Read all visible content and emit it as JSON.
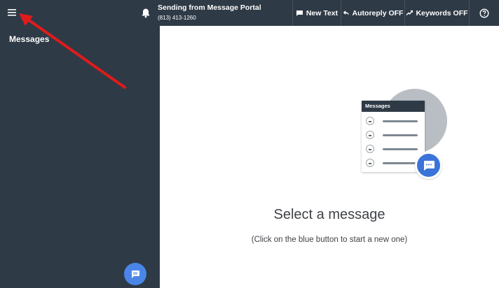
{
  "header": {
    "sender_title": "Sending from Message Portal",
    "sender_phone": "(813) 413-1260",
    "buttons": {
      "new_text": "New Text",
      "autoreply": "Autoreply OFF",
      "keywords": "Keywords OFF"
    }
  },
  "sidebar": {
    "title": "Messages"
  },
  "main": {
    "card_title": "Messages",
    "heading": "Select a message",
    "subtext": "(Click on the blue button to start a new one)"
  },
  "colors": {
    "topbar": "#2e3a46",
    "accent_blue": "#4a86e8",
    "annotation_arrow": "#e01b1b"
  },
  "icons": [
    "menu-icon",
    "bell-icon",
    "chat-icon",
    "reply-icon",
    "keyword-icon",
    "help-icon",
    "new-message-icon"
  ]
}
